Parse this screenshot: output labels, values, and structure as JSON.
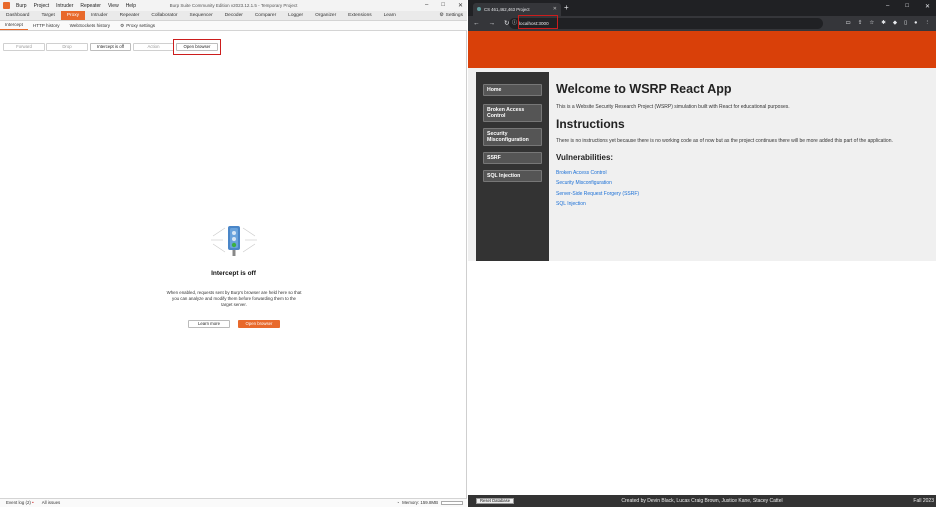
{
  "burp": {
    "menu": [
      "Burp",
      "Project",
      "Intruder",
      "Repeater",
      "View",
      "Help"
    ],
    "window_title": "Burp Suite Community Edition v2023.12.1.5 - Temporary Project",
    "main_tabs": [
      "Dashboard",
      "Target",
      "Proxy",
      "Intruder",
      "Repeater",
      "Collaborator",
      "Sequencer",
      "Decoder",
      "Comparer",
      "Logger",
      "Organizer",
      "Extensions",
      "Learn"
    ],
    "active_main_tab": "Proxy",
    "settings_label": "Settings",
    "sub_tabs": [
      "Intercept",
      "HTTP history",
      "WebSockets history"
    ],
    "proxy_settings_label": "Proxy settings",
    "toolbar": {
      "forward": "Forward",
      "drop": "Drop",
      "intercept": "Intercept is off",
      "action": "Action",
      "open_browser": "Open browser"
    },
    "intercept_panel": {
      "title": "Intercept is off",
      "description": "When enabled, requests sent by Burp's browser are held here so that you can analyze and modify them before forwarding them to the target server.",
      "learn_more": "Learn more",
      "open_browser": "Open browser"
    },
    "status_bar": {
      "event_log": "Event log (2)",
      "all_issues": "All issues",
      "memory": "Memory: 159.8MB"
    }
  },
  "browser": {
    "tab_title": "CS 461,462,463 Project",
    "url": "localhost:3000",
    "site": {
      "nav": [
        "Home",
        "Broken Access Control",
        "Security Misconfiguration",
        "SSRF",
        "SQL Injection"
      ],
      "welcome": "Welcome to WSRP React App",
      "intro": "This is a Website Security Research Project (WSRP) simulation built with React for educational purposes.",
      "instructions_heading": "Instructions",
      "instructions_text": "There is no instructions yet because there is no working code as of now but as the project continues there will be more added this part of the application.",
      "vulnerabilities_heading": "Vulnerabilities:",
      "vulnerabilities": [
        "Broken Access Control",
        "Security Misconfiguration",
        "Server-Side Request Forgery (SSRF)",
        "SQL Injection"
      ],
      "footer": {
        "reset": "Reset Database",
        "credits": "Created by Devin Black, Lucas Craig Brown, Justice Kane, Stacey Cattel",
        "term": "Fall 2023"
      }
    }
  },
  "colors": {
    "burp_accent": "#e8692b",
    "site_header": "#d94009",
    "highlight": "#cc1d1d",
    "link": "#1a6fd6"
  }
}
